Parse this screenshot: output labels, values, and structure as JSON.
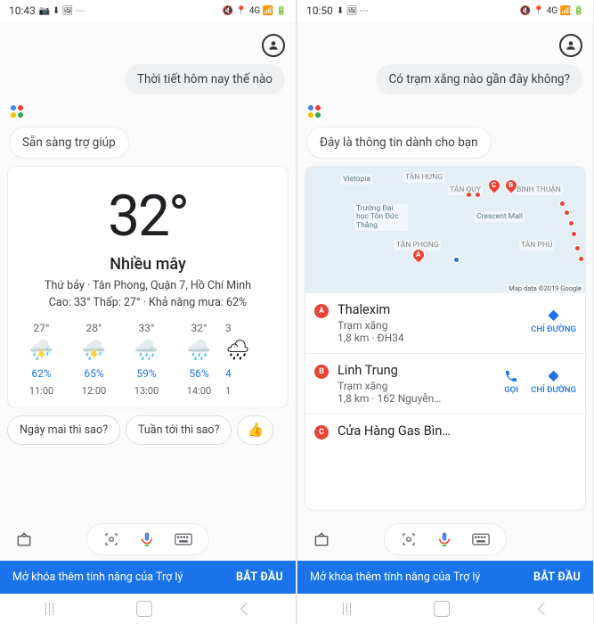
{
  "left": {
    "status": {
      "time": "10:43",
      "icons": "📷 ⬇ 🖼 ⋯",
      "right": "🔇 📍 4G 📶 🔋"
    },
    "user_query": "Thời tiết hôm nay thế nào",
    "assistant_reply": "Sẵn sàng trợ giúp",
    "weather": {
      "temp": "32°",
      "condition": "Nhiều mây",
      "location": "Thứ bảy · Tân Phong, Quận 7, Hồ Chí Minh",
      "summary": "Cao: 33° Thấp: 27° · Khả năng mưa: 62%",
      "hourly": [
        {
          "temp": "27°",
          "pct": "62%",
          "time": "11:00"
        },
        {
          "temp": "28°",
          "pct": "65%",
          "time": "12:00"
        },
        {
          "temp": "33°",
          "pct": "59%",
          "time": "13:00"
        },
        {
          "temp": "32°",
          "pct": "56%",
          "time": "14:00"
        },
        {
          "temp": "3",
          "pct": "4",
          "time": "1"
        }
      ]
    },
    "chips": [
      "Ngày mai thì sao?",
      "Tuần tới thì sao?"
    ],
    "chip_emoji": "👍",
    "unlock": {
      "text": "Mở khóa thêm tính năng của Trợ lý",
      "cta": "BẮT ĐẦU"
    }
  },
  "right": {
    "status": {
      "time": "10:50",
      "icons": "⬇ 🖼 ⋯",
      "right": "🔇 📍 4G 📶 🔋"
    },
    "user_query": "Có trạm xăng nào gần đây không?",
    "assistant_reply": "Đây là thông tin dành cho bạn",
    "map": {
      "labels": [
        "Vietopia",
        "TÂN HƯNG",
        "TÂN QUY",
        "BÌNH THUẬN",
        "Trường Đại học Tôn Đức Thắng",
        "Crescent Mall",
        "TÂN PHONG",
        "TÂN PHÚ"
      ],
      "attribution": "Map data ©2019 Google"
    },
    "places": [
      {
        "letter": "A",
        "name": "Thalexim",
        "type": "Trạm xăng",
        "dist": "1,8 km · ĐH34",
        "actions": [
          {
            "icon": "◆",
            "label": "CHỈ ĐƯỜNG"
          }
        ]
      },
      {
        "letter": "B",
        "name": "Linh Trung",
        "type": "Trạm xăng",
        "dist": "1,8 km · 162 Nguyễn…",
        "actions": [
          {
            "icon": "📞",
            "label": "GỌI"
          },
          {
            "icon": "◆",
            "label": "CHỈ ĐƯỜNG"
          }
        ]
      },
      {
        "letter": "C",
        "name": "Cửa Hàng Gas Bìn…",
        "type": "",
        "dist": "",
        "actions": []
      }
    ],
    "unlock": {
      "text": "Mở khóa thêm tính năng của Trợ lý",
      "cta": "BẮT ĐẦU"
    }
  }
}
